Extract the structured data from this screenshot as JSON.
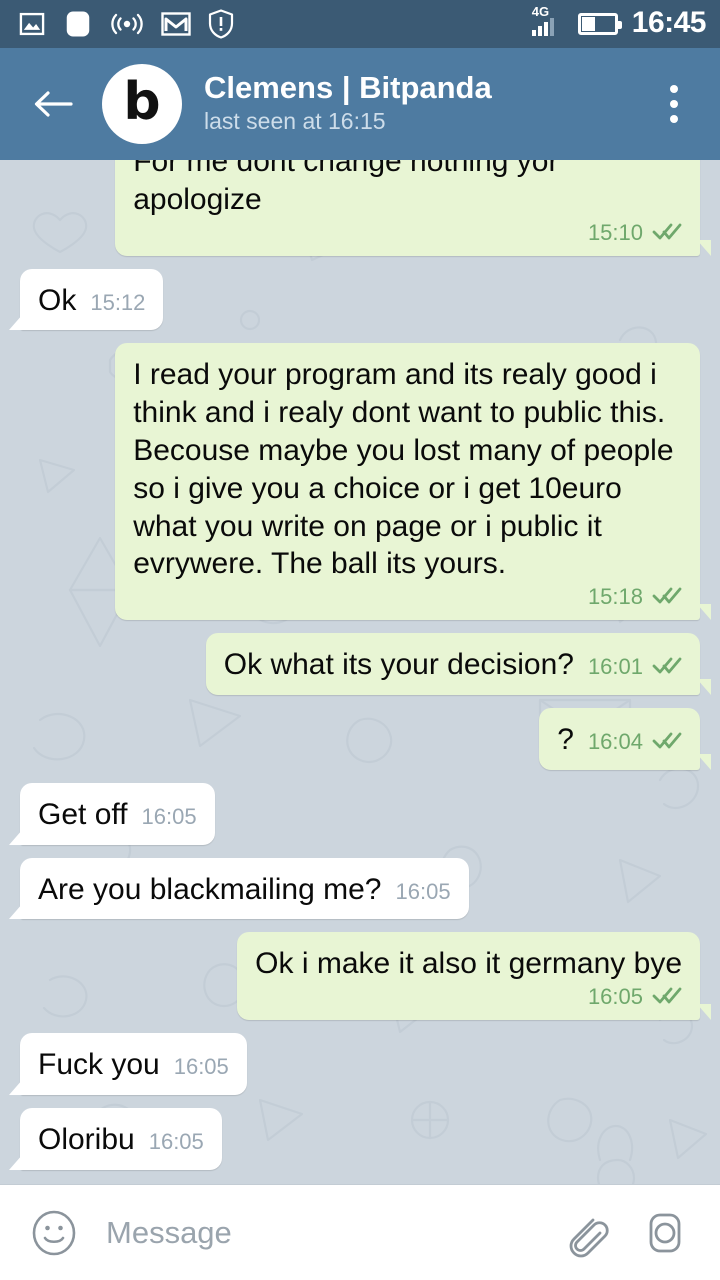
{
  "status_bar": {
    "icons": [
      "image-icon",
      "rounded-square-icon",
      "cast-icon",
      "gmail-icon",
      "shield-alert-icon"
    ],
    "network_label": "4G",
    "signal_bars_filled": 3,
    "signal_bars_total": 4,
    "battery_percent": 40,
    "clock": "16:45",
    "background_color": "#3b5a74"
  },
  "header": {
    "back_icon": "back-arrow-icon",
    "avatar_letter": "b",
    "title": "Clemens | Bitpanda",
    "subtitle": "last seen at 16:15",
    "menu_icon": "overflow-menu-icon",
    "background_color": "#4e7ba1"
  },
  "chat": {
    "background_color": "#ccd5dd",
    "incoming_bubble_color": "#ffffff",
    "outgoing_bubble_color": "#e8f5d4",
    "outgoing_meta_color": "#6fa86c",
    "incoming_meta_color": "#9aa7b3",
    "ticks_glyph": "✓✓",
    "messages": [
      {
        "direction": "outgoing",
        "text": "For me dont change nothing yor apologize",
        "time": "15:10",
        "status": "read",
        "layout": "block",
        "clipped": true
      },
      {
        "direction": "incoming",
        "text": "Ok",
        "time": "15:12",
        "status": "none",
        "layout": "inline",
        "clipped": false
      },
      {
        "direction": "outgoing",
        "text": "I read your program and its realy good i think and i realy dont want to public this. Becouse maybe you lost many of people so i give you a choice or i get 10euro what you write on page or i public it evrywere. The ball its yours.",
        "time": "15:18",
        "status": "read",
        "layout": "block",
        "clipped": false
      },
      {
        "direction": "outgoing",
        "text": "Ok what its your decision?",
        "time": "16:01",
        "status": "read",
        "layout": "inline",
        "clipped": false
      },
      {
        "direction": "outgoing",
        "text": "?",
        "time": "16:04",
        "status": "read",
        "layout": "inline",
        "clipped": false
      },
      {
        "direction": "incoming",
        "text": "Get off",
        "time": "16:05",
        "status": "none",
        "layout": "inline",
        "clipped": false
      },
      {
        "direction": "incoming",
        "text": "Are you blackmailing me?",
        "time": "16:05",
        "status": "none",
        "layout": "inline",
        "clipped": false
      },
      {
        "direction": "outgoing",
        "text": "Ok i make it also it germany bye",
        "time": "16:05",
        "status": "read",
        "layout": "block",
        "clipped": false
      },
      {
        "direction": "incoming",
        "text": "Fuck you",
        "time": "16:05",
        "status": "none",
        "layout": "inline",
        "clipped": false
      },
      {
        "direction": "incoming",
        "text": "Oloribu",
        "time": "16:05",
        "status": "none",
        "layout": "inline",
        "clipped": false
      }
    ]
  },
  "input_bar": {
    "emoji_icon": "smiley-icon",
    "placeholder": "Message",
    "value": "",
    "attach_icon": "paperclip-icon",
    "camera_icon": "camera-icon",
    "background_color": "#ffffff"
  }
}
